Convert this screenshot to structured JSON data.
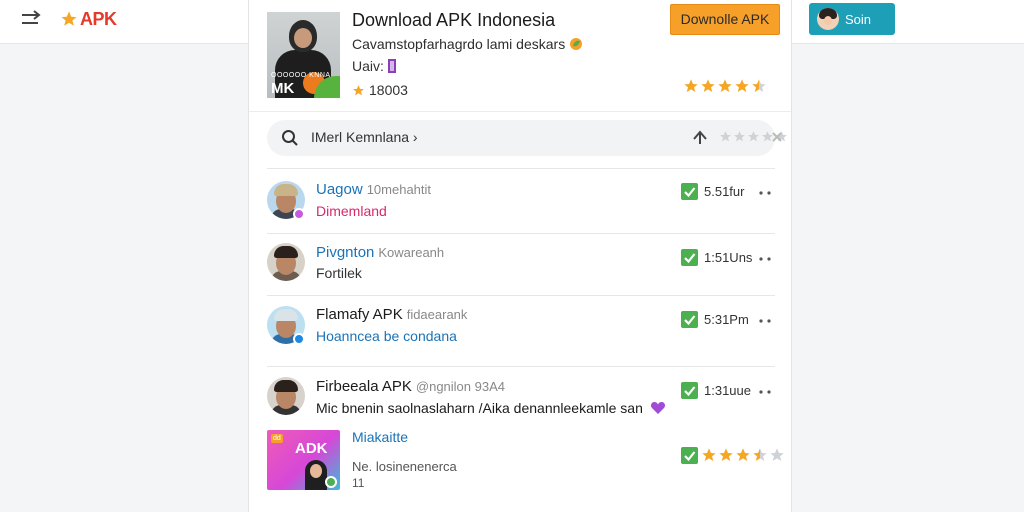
{
  "topbar": {
    "brand": "APK",
    "account_label": "Soin"
  },
  "app": {
    "title": "Download APK Indonesia",
    "description": "Cavamstopfarhagrdo lami deskars",
    "version_label": "Uaiv:",
    "count": "18003",
    "thumb_caption": "OOOOOO KNNA",
    "thumb_brand": "MK",
    "download_label": "Downolle APK",
    "rating": 4.5
  },
  "search": {
    "placeholder": "IMerl Kemnlana ›",
    "rating": 0
  },
  "items": [
    {
      "name": "Uagow",
      "handle": "10mehahtit",
      "subtitle": "Dimemland",
      "name_color": "#1a73b8",
      "sub_color": "#d8286b",
      "time": "5.51fur",
      "badge_color": "#c75be0"
    },
    {
      "name": "Pivgnton",
      "handle": "Kowareanh",
      "subtitle": "Fortilek",
      "name_color": "#1a73b8",
      "sub_color": "#333333",
      "time": "1:51Uns",
      "badge_color": ""
    },
    {
      "name": "Flamafy APK",
      "handle": "fidaearank",
      "subtitle": "Hoanncea be condana",
      "name_color": "#1b1b1b",
      "sub_color": "#1a73b8",
      "time": "5:31Pm",
      "badge_color": "#1e88e5"
    },
    {
      "name": "Firbeeala APK",
      "handle": "@ngnilon 93A4",
      "subtitle": "Mic bnenin saolnaslaharn /Aika denannleekamle san",
      "name_color": "#1b1b1b",
      "sub_color": "#1b1b1b",
      "time": "1:31uue",
      "badge_color": ""
    }
  ],
  "promo": {
    "thumb_label": "ADK",
    "mini_tag": "dd",
    "title": "Miakaitte",
    "subtitle": "Ne. losinenenerca",
    "subtitle2": "11",
    "rating": 3.5
  },
  "colors": {
    "accent_orange": "#f6a02a",
    "brand_red": "#e33a2c",
    "teal": "#1e9fb8",
    "check_green": "#4caf50",
    "star": "#f5a623"
  }
}
